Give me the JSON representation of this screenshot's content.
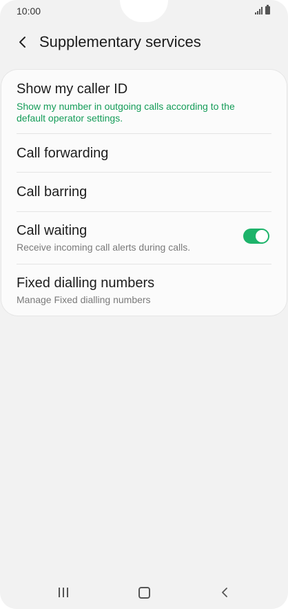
{
  "status_bar": {
    "time": "10:00",
    "signal_icon": "signal-icon",
    "battery_icon": "battery-icon"
  },
  "header": {
    "back_icon": "chevron-left-icon",
    "title": "Supplementary services"
  },
  "settings": {
    "caller_id": {
      "title": "Show my caller ID",
      "subtitle_line1": "Show my number in outgoing calls according to the",
      "subtitle_line2": "default operator settings."
    },
    "call_forwarding": {
      "title": "Call forwarding"
    },
    "call_barring": {
      "title": "Call barring"
    },
    "call_waiting": {
      "title": "Call waiting",
      "subtitle": "Receive incoming call alerts during calls.",
      "enabled": true
    },
    "fixed_dialling": {
      "title": "Fixed dialling numbers",
      "subtitle": "Manage Fixed dialling numbers"
    }
  },
  "nav_bar": {
    "recents_icon": "recents-icon",
    "home_icon": "home-icon",
    "back_icon": "back-icon"
  },
  "colors": {
    "accent": "#149c58",
    "toggle_on": "#1db36a",
    "background": "#f2f2f2",
    "card": "#fbfbfb"
  }
}
